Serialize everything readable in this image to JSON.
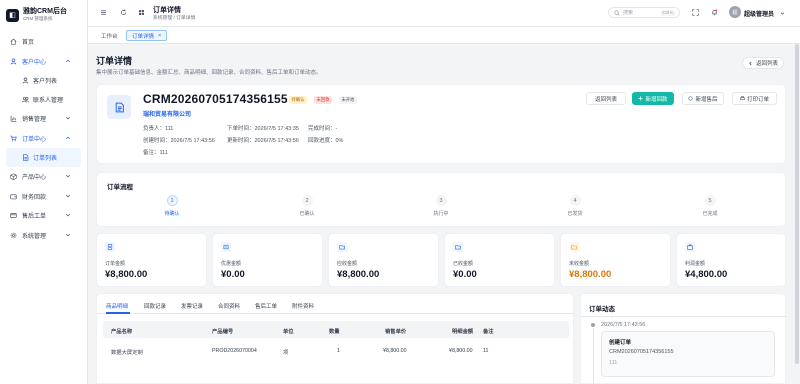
{
  "brand": {
    "title": "雅韵CRM后台",
    "subtitle": "CRM 管理系统"
  },
  "sidebar": {
    "items": [
      {
        "label": "首页"
      },
      {
        "label": "客户中心"
      },
      {
        "label": "客户列表"
      },
      {
        "label": "联系人管理"
      },
      {
        "label": "销售管理"
      },
      {
        "label": "订单中心"
      },
      {
        "label": "订单列表"
      },
      {
        "label": "产品中心"
      },
      {
        "label": "财务回款"
      },
      {
        "label": "售后工单"
      },
      {
        "label": "系统管理"
      }
    ]
  },
  "header": {
    "title": "订单详情",
    "breadcrumb": "系统管理 / 订单详情",
    "search_placeholder": "搜索",
    "search_shortcut": "Ctrl K",
    "avatar_text": "超",
    "username": "超级管理员"
  },
  "tabs": [
    {
      "label": "工作台"
    },
    {
      "label": "订单详情"
    },
    {
      "close": "×"
    }
  ],
  "page": {
    "title": "订单详情",
    "description": "集中展示订单基础信息、金额汇总、商品明细、回款记录、合同资料、售后工单和订单动态。",
    "back_label": "返回列表"
  },
  "order": {
    "number": "CRM20260705174356155",
    "badges": [
      "待确认",
      "未回款",
      "未开始"
    ],
    "company": "瑞和贸易有限公司",
    "owner": "负责人：111",
    "order_time": "下单时间：2026/7/5 17:43:35",
    "complete_time": "完成时间：-",
    "created_time": "创建时间：2026/7/5 17:43:56",
    "updated_time": "更新时间：2026/7/5 17:43:56",
    "payment_progress": "回款进度：0%",
    "remark": "备注：111",
    "actions": {
      "back": "返回列表",
      "add_payment": "新增回款",
      "add_service": "新增售后",
      "print": "打印订单"
    }
  },
  "flow": {
    "title": "订单流程",
    "steps": [
      {
        "num": "1",
        "label": "待确认"
      },
      {
        "num": "2",
        "label": "已确认"
      },
      {
        "num": "3",
        "label": "执行中"
      },
      {
        "num": "4",
        "label": "已发货"
      },
      {
        "num": "5",
        "label": "已完成"
      }
    ]
  },
  "stats": [
    {
      "label": "订单金额",
      "value": "¥8,800.00"
    },
    {
      "label": "优惠金额",
      "value": "¥0.00"
    },
    {
      "label": "应收金额",
      "value": "¥8,800.00"
    },
    {
      "label": "已收金额",
      "value": "¥0.00"
    },
    {
      "label": "未收金额",
      "value": "¥8,800.00"
    },
    {
      "label": "利润金额",
      "value": "¥4,800.00"
    }
  ],
  "detail_tabs": [
    "商品明细",
    "回款记录",
    "发票记录",
    "合同资料",
    "售后工单",
    "附件资料"
  ],
  "table": {
    "headers": [
      "产品名称",
      "产品编号",
      "单位",
      "数量",
      "销售单价",
      "明细金额",
      "备注"
    ],
    "rows": [
      [
        "数据大屏定制",
        "PROD2026070004",
        "项",
        "1",
        "¥8,800.00",
        "¥8,800.00",
        "11"
      ]
    ]
  },
  "activity": {
    "title": "订单动态",
    "time": "2026/7/5 17:43:56",
    "event_title": "创建订单",
    "event_order": "CRM20260705174356155",
    "event_user": "111"
  },
  "colors": {
    "accent": "#2563eb",
    "primary_btn": "#14b8a6",
    "warning": "#f59e0b"
  }
}
